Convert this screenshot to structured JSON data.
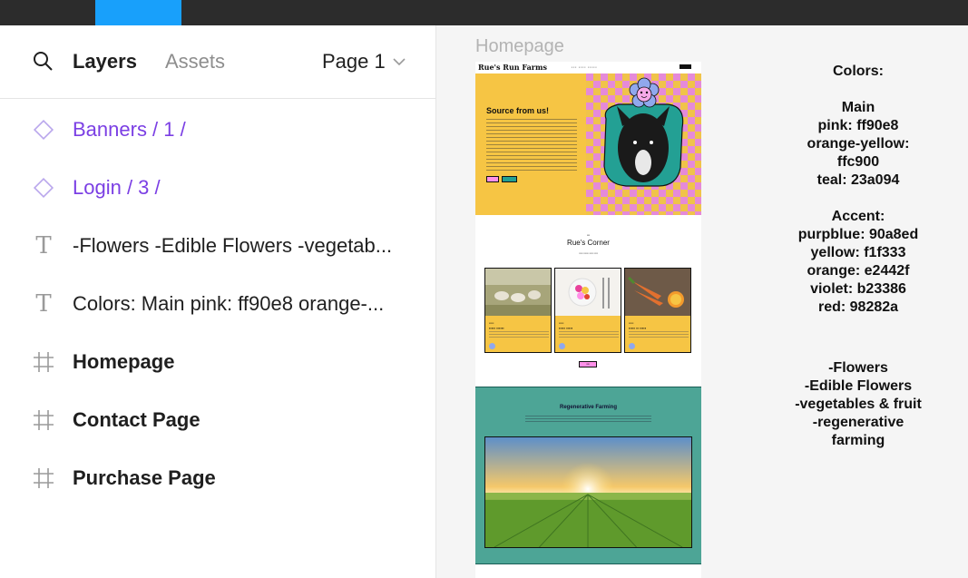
{
  "panel": {
    "tab_layers": "Layers",
    "tab_assets": "Assets",
    "page_select": "Page 1",
    "layers": [
      {
        "label": "Banners / 1 /"
      },
      {
        "label": "Login / 3 /"
      },
      {
        "label": "-Flowers -Edible Flowers -vegetab..."
      },
      {
        "label": "Colors: Main pink: ff90e8 orange-..."
      },
      {
        "label": "Homepage"
      },
      {
        "label": "Contact Page"
      },
      {
        "label": "Purchase Page"
      }
    ]
  },
  "canvas": {
    "frame_label": "Homepage",
    "homepage": {
      "brand": "Rue's Run Farms",
      "hero_title": "Source from us!",
      "corner_title": "Rue's Corner"
    },
    "colors_note": [
      "Colors:",
      "",
      "Main",
      "pink: ff90e8",
      "orange-yellow: ffc900",
      "teal: 23a094",
      "",
      "Accent:",
      "purpblue: 90a8ed",
      "yellow: f1f333",
      "orange: e2442f",
      "violet: b23386",
      "red: 98282a"
    ],
    "flowers_note": [
      "-Flowers",
      "-Edible Flowers",
      "-vegetables & fruit",
      "-regenerative farming"
    ],
    "regen_title": "Regenerative Farming"
  },
  "colors": {
    "accent_blue": "#18a0fb",
    "component_purple": "#7b3fe4",
    "pink": "#ff90e8",
    "yellow": "#f6c544",
    "teal": "#23a094"
  }
}
